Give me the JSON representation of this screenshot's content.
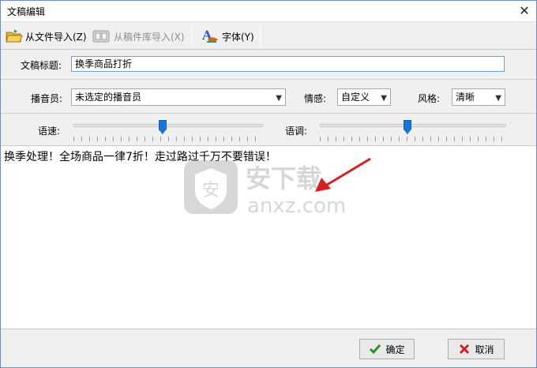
{
  "window": {
    "title": "文稿编辑",
    "close_label": "✕"
  },
  "toolbar": {
    "import_file_label": "从文件导入(Z)",
    "import_library_label": "从稿件库导入(X)",
    "font_label": "字体(Y)"
  },
  "form": {
    "title_label": "文稿标题:",
    "title_value": "换季商品打折",
    "announcer_label": "播音员:",
    "announcer_value": "未选定的播音员",
    "emotion_label": "情感:",
    "emotion_value": "自定义",
    "style_label": "风格:",
    "style_value": "清晰",
    "speed_label": "语速:",
    "speed_level": 0.47,
    "pitch_label": "语调:",
    "pitch_level": 0.47
  },
  "editor": {
    "content": "换季处理！全场商品一律7折！走过路过千万不要错误！"
  },
  "watermark": {
    "brand_cn": "安下载",
    "brand_domain": "anxz.com",
    "shield_text": "安"
  },
  "footer": {
    "ok_label": "确定",
    "cancel_label": "取消"
  },
  "colors": {
    "slider_thumb": "#1874d6",
    "ok_check": "#2a8f2a",
    "cancel_x": "#d22020",
    "arrow": "#d61f1f"
  }
}
